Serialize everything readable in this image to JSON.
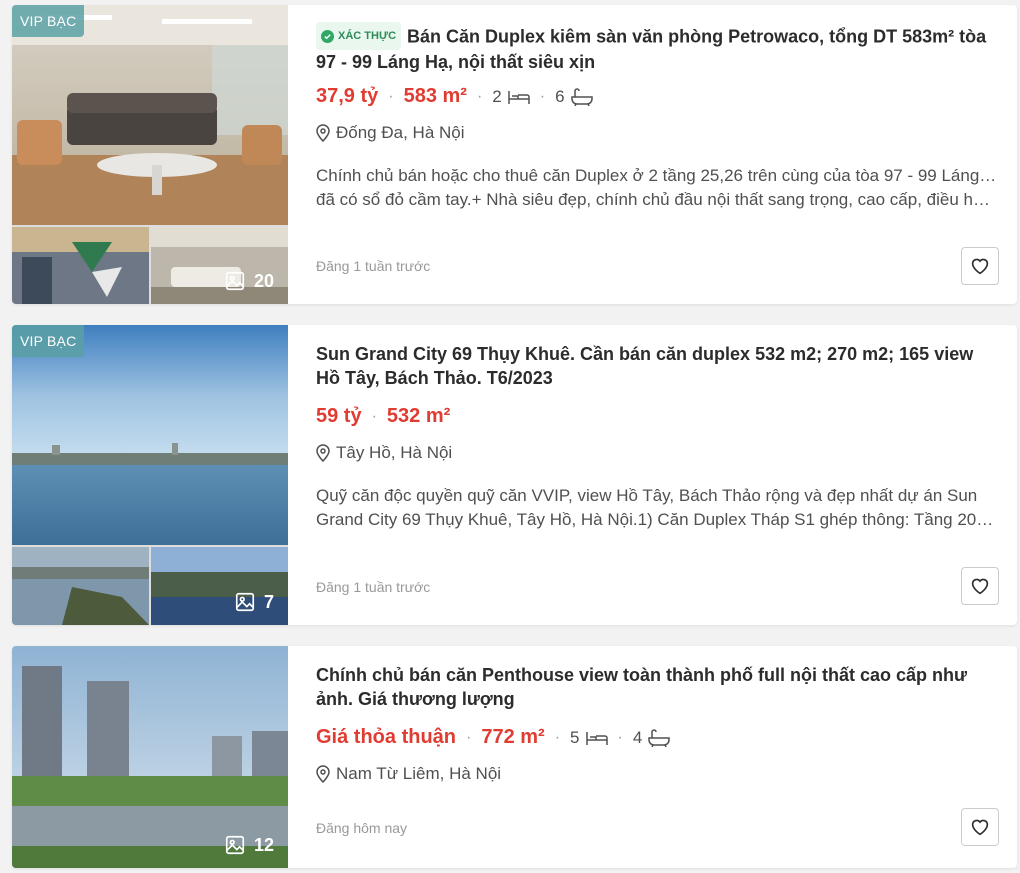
{
  "listings": [
    {
      "badge": "VIP BẠC",
      "verified": "XÁC THỰC",
      "title": "Bán Căn Duplex kiêm sàn văn phòng Petrowaco, tổng DT 583m² tòa 97 - 99 Láng Hạ, nội thất siêu xịn",
      "price": "37,9 tỷ",
      "area": "583 m²",
      "bedrooms": "2",
      "bathrooms": "6",
      "location": "Đống Đa, Hà Nội",
      "description_line1": "Chính chủ bán hoặc cho thuê căn Duplex ở 2 tầng 25,26 trên cùng của tòa 97 - 99 Láng Hạ,",
      "description_line2": "đã có sổ đỏ cầm tay.+ Nhà siêu đẹp, chính chủ đầu nội thất sang trọng, cao cấp, điều hòa...",
      "posted": "Đăng 1 tuần trước",
      "photo_count": "20"
    },
    {
      "badge": "VIP BẠC",
      "title": "Sun Grand City 69 Thụy Khuê. Cần bán căn duplex 532 m2; 270 m2; 165 view Hồ Tây, Bách Thảo. T6/2023",
      "price": "59 tỷ",
      "area": "532 m²",
      "location": "Tây Hồ, Hà Nội",
      "description_line1": "Quỹ căn độc quyền quỹ căn VVIP, view Hồ Tây, Bách Thảo rộng và đẹp nhất dự án Sun",
      "description_line2": "Grand City 69 Thụy Khuê, Tây Hồ, Hà Nội.1) Căn Duplex Tháp S1 ghép thông: Tầng 20, vie...",
      "posted": "Đăng 1 tuần trước",
      "photo_count": "7"
    },
    {
      "title": "Chính chủ bán căn Penthouse view toàn thành phố full nội thất cao cấp như ảnh. Giá thương lượng",
      "price": "Giá thỏa thuận",
      "area": "772 m²",
      "bedrooms": "5",
      "bathrooms": "4",
      "location": "Nam Từ Liêm, Hà Nội",
      "posted": "Đăng hôm nay",
      "photo_count": "12"
    }
  ],
  "colors": {
    "price": "#e03c31",
    "badge": "#5aa0a5",
    "verified": "#2fa866"
  },
  "icons": [
    "bed-icon",
    "bath-icon",
    "location-pin-icon",
    "image-icon",
    "heart-icon",
    "check-shield-icon"
  ]
}
